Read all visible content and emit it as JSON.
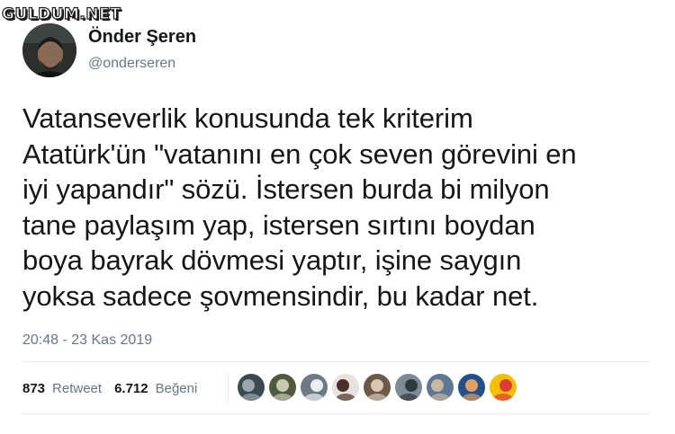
{
  "watermark": "GULDUM.NET",
  "author": {
    "display_name": "Önder Şeren",
    "handle": "@onderseren"
  },
  "tweet": {
    "text": "Vatanseverlik konusunda tek kriterim\nAtatürk'ün \"vatanını en çok seven görevini en\niyi yapandır\" sözü. İstersen burda bi milyon\ntane paylaşım yap, istersen sırtını boydan\nboya bayrak dövmesi yaptır, işine saygın\nyoksa sadece şovmensindir, bu kadar net.",
    "timestamp": "20:48 - 23 Kas 2019"
  },
  "stats": {
    "retweet_count": "873",
    "retweet_label": "Retweet",
    "like_count": "6.712",
    "like_label": "Beğeni"
  },
  "colors": {
    "text_primary": "#14171a",
    "text_secondary": "#657786",
    "divider": "#e6ecf0"
  },
  "likers": [
    {
      "name": "liker-avatar-1",
      "bg": "#3b4a52",
      "fg": "#9aa7ae"
    },
    {
      "name": "liker-avatar-2",
      "bg": "#4f5a3d",
      "fg": "#c9c7b5"
    },
    {
      "name": "liker-avatar-3",
      "bg": "#6d7a86",
      "fg": "#e9eef2"
    },
    {
      "name": "liker-avatar-4",
      "bg": "#e8e2de",
      "fg": "#4b2f2a"
    },
    {
      "name": "liker-avatar-5",
      "bg": "#6a5a4a",
      "fg": "#d9c6b0"
    },
    {
      "name": "liker-avatar-6",
      "bg": "#7c8b94",
      "fg": "#2e3a40"
    },
    {
      "name": "liker-avatar-7",
      "bg": "#5c7894",
      "fg": "#c8b89c"
    },
    {
      "name": "liker-avatar-8",
      "bg": "#1f4f8c",
      "fg": "#e0a060"
    },
    {
      "name": "liker-avatar-9",
      "bg": "#f2c200",
      "fg": "#e03a3a"
    }
  ]
}
